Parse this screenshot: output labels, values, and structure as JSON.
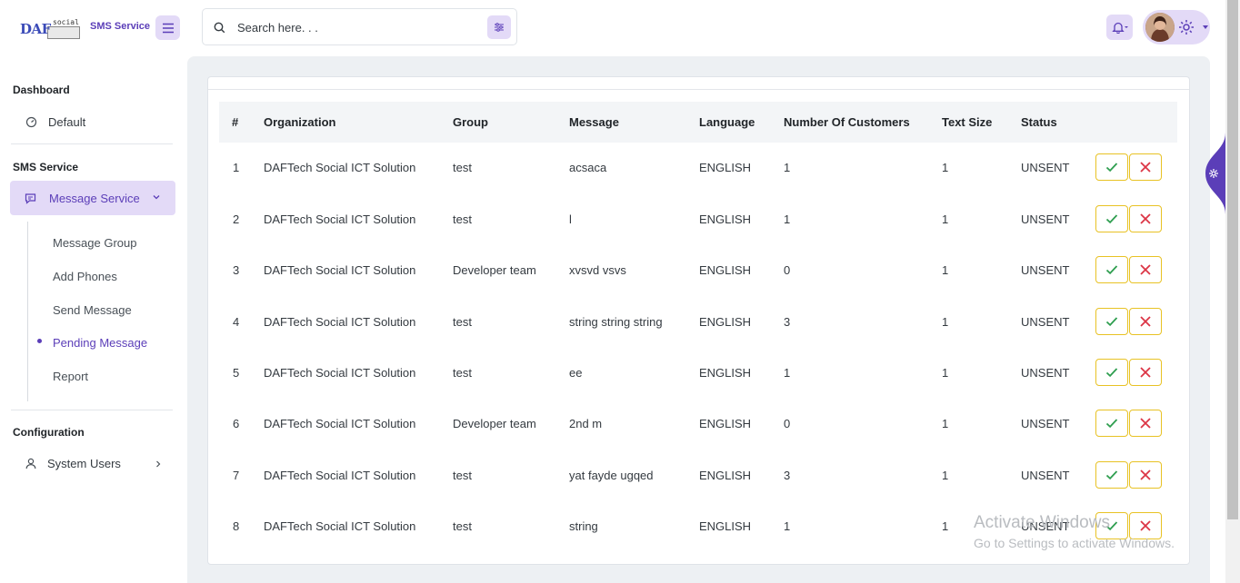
{
  "brand": {
    "logo_text": "DAF",
    "logo_sub": "social",
    "name": "SMS Service"
  },
  "search": {
    "placeholder": "Search here. . ."
  },
  "sidebar": {
    "dashboard_title": "Dashboard",
    "default_label": "Default",
    "sms_title": "SMS Service",
    "message_service_label": "Message Service",
    "sub_items": [
      "Message Group",
      "Add Phones",
      "Send Message",
      "Pending Message",
      "Report"
    ],
    "config_title": "Configuration",
    "system_users_label": "System Users"
  },
  "table": {
    "headers": [
      "#",
      "Organization",
      "Group",
      "Message",
      "Language",
      "Number Of Customers",
      "Text Size",
      "Status"
    ],
    "rows": [
      [
        "1",
        "DAFTech Social ICT Solution",
        "test",
        "acsaca",
        "ENGLISH",
        "1",
        "1",
        "UNSENT"
      ],
      [
        "2",
        "DAFTech Social ICT Solution",
        "test",
        "l",
        "ENGLISH",
        "1",
        "1",
        "UNSENT"
      ],
      [
        "3",
        "DAFTech Social ICT Solution",
        "Developer team",
        "xvsvd vsvs",
        "ENGLISH",
        "0",
        "1",
        "UNSENT"
      ],
      [
        "4",
        "DAFTech Social ICT Solution",
        "test",
        "string string string",
        "ENGLISH",
        "3",
        "1",
        "UNSENT"
      ],
      [
        "5",
        "DAFTech Social ICT Solution",
        "test",
        "ee",
        "ENGLISH",
        "1",
        "1",
        "UNSENT"
      ],
      [
        "6",
        "DAFTech Social ICT Solution",
        "Developer team",
        "2nd m",
        "ENGLISH",
        "0",
        "1",
        "UNSENT"
      ],
      [
        "7",
        "DAFTech Social ICT Solution",
        "test",
        "yat fayde ugqed",
        "ENGLISH",
        "3",
        "1",
        "UNSENT"
      ],
      [
        "8",
        "DAFTech Social ICT Solution",
        "test",
        "string",
        "ENGLISH",
        "1",
        "1",
        "UNSENT"
      ]
    ]
  },
  "watermark": {
    "line1": "Activate Windows",
    "line2": "Go to Settings to activate Windows."
  },
  "colors": {
    "accent": "#5b3eb8",
    "accent_soft": "#e3daf7",
    "approve": "#2e9e4f",
    "reject": "#dc3545",
    "action_border": "#e8c224"
  },
  "icons": [
    "menu-icon",
    "search-icon",
    "filter-icon",
    "bell-icon",
    "settings-icon",
    "dashboard-icon",
    "message-icon",
    "user-icon",
    "check-icon",
    "close-icon"
  ]
}
